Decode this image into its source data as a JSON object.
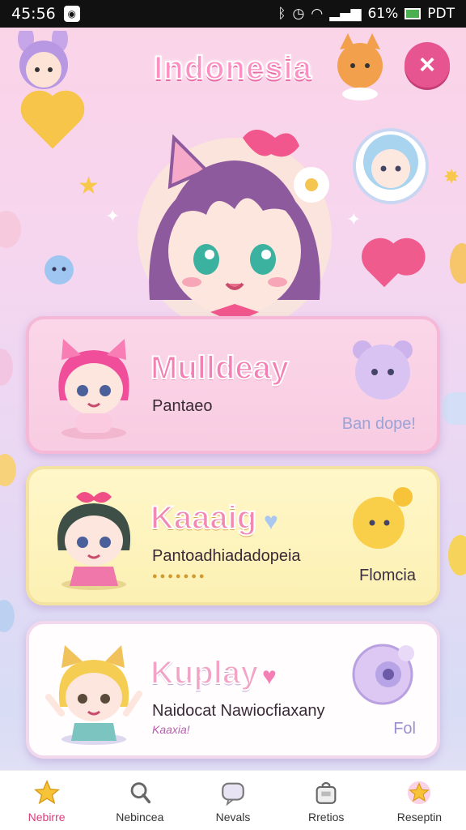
{
  "status_bar": {
    "time": "45:56",
    "battery_text": "61%",
    "carrier": "PDT"
  },
  "header": {
    "title": "Indonesia",
    "close_label": "×"
  },
  "cards": [
    {
      "name": "Mulldeay",
      "subtitle": "Pantaeo",
      "tag": "Ban dope!"
    },
    {
      "name": "Kaaaig",
      "subtitle": "Pantoadhiadadopeia",
      "tag": "Flomcia"
    },
    {
      "name": "Kuplay",
      "subtitle": "Naidocat Nawiocfiaxany",
      "subtitle2": "Kaaxia!",
      "tag": "Fol"
    }
  ],
  "nav": {
    "items": [
      {
        "label": "Nebirre",
        "icon": "star-icon"
      },
      {
        "label": "Nebincea",
        "icon": "magnifier-icon"
      },
      {
        "label": "Nevals",
        "icon": "chat-icon"
      },
      {
        "label": "Rretios",
        "icon": "bag-icon"
      },
      {
        "label": "Reseptin",
        "icon": "star-badge-icon"
      }
    ],
    "active_index": 0
  },
  "colors": {
    "accent": "#e6558f",
    "title": "#ff8fc2",
    "background_top": "#fbd3e6",
    "background_bottom": "#d8dcf5"
  }
}
